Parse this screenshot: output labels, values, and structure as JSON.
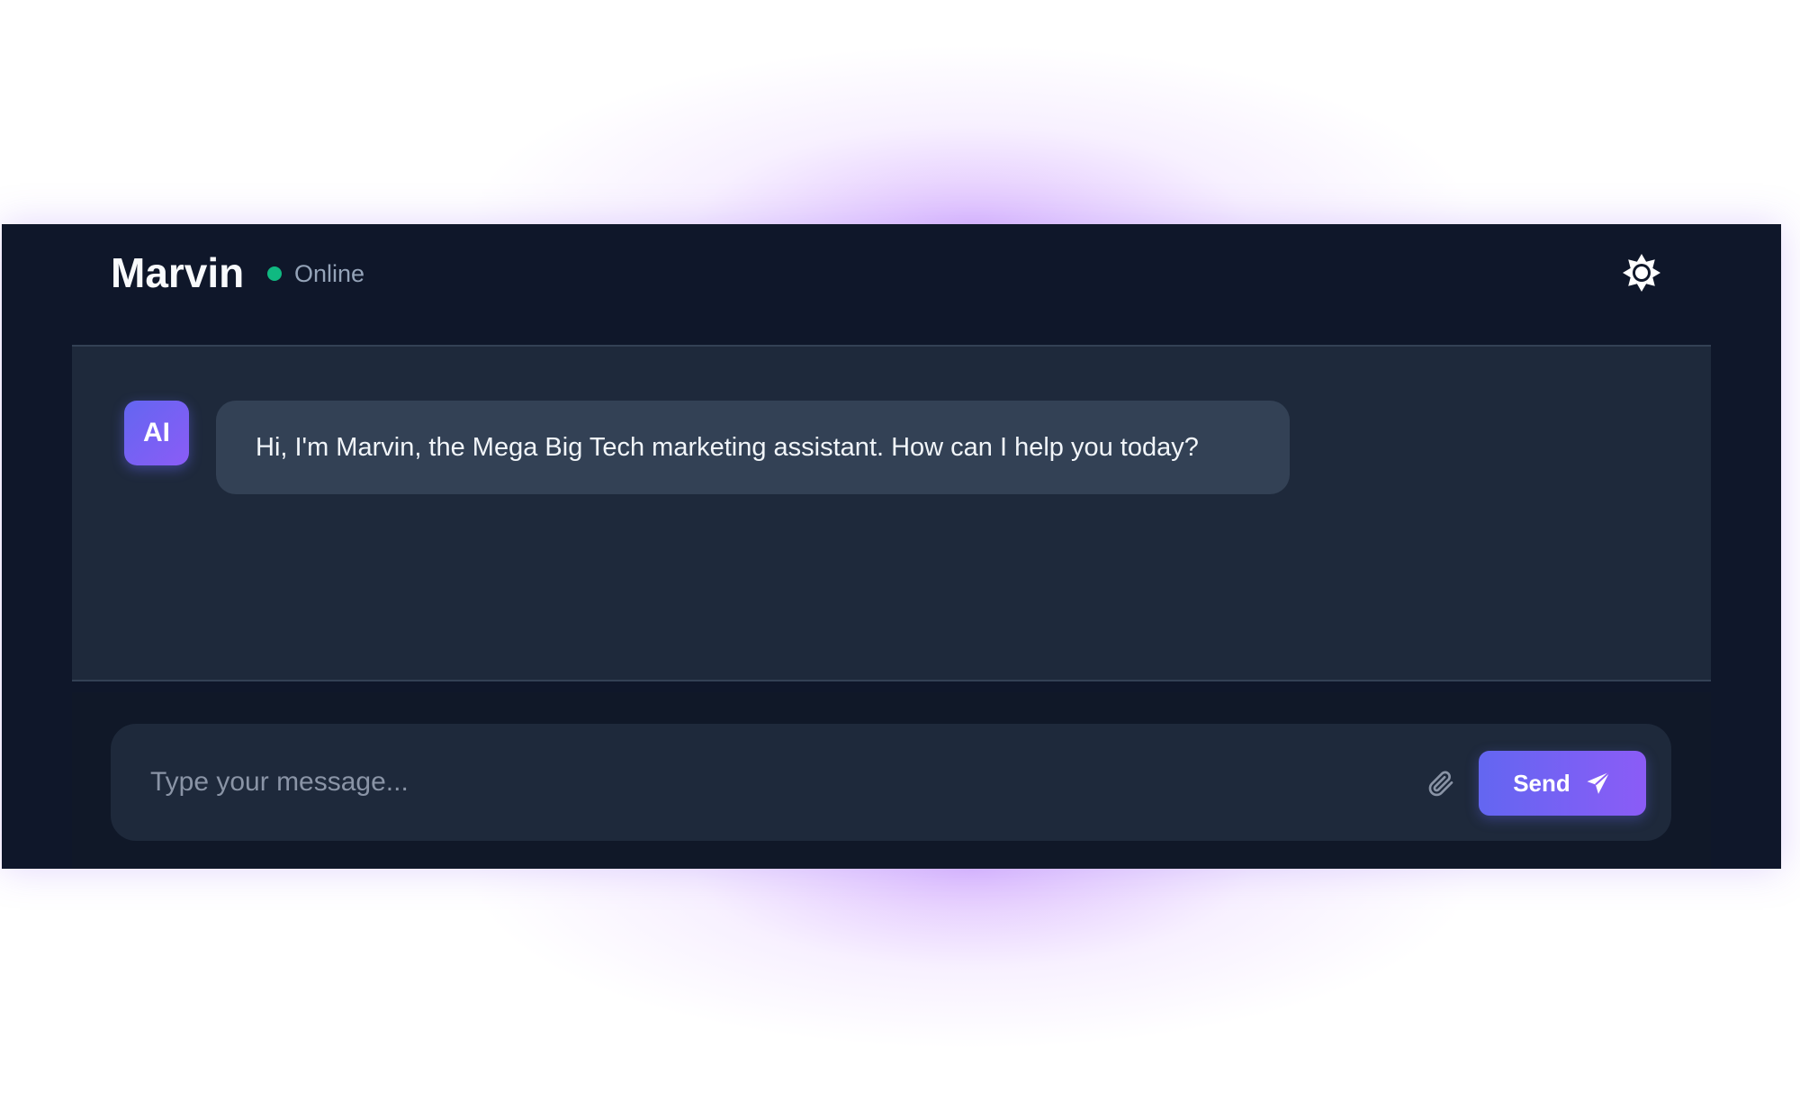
{
  "header": {
    "title": "Marvin",
    "status": "Online",
    "status_color": "#10b981",
    "theme_icon": "sun-icon"
  },
  "messages": [
    {
      "sender": "AI",
      "text": "Hi, I'm Marvin, the Mega Big Tech marketing assistant. How can I help you today?"
    }
  ],
  "composer": {
    "placeholder": "Type your message...",
    "attach_icon": "paperclip-icon",
    "send_label": "Send",
    "send_icon": "paper-plane-icon"
  },
  "colors": {
    "background": "#0f172a",
    "chat_panel": "#1e293b",
    "bubble": "#334155",
    "accent_start": "#6366f1",
    "accent_end": "#8b5cf6"
  }
}
